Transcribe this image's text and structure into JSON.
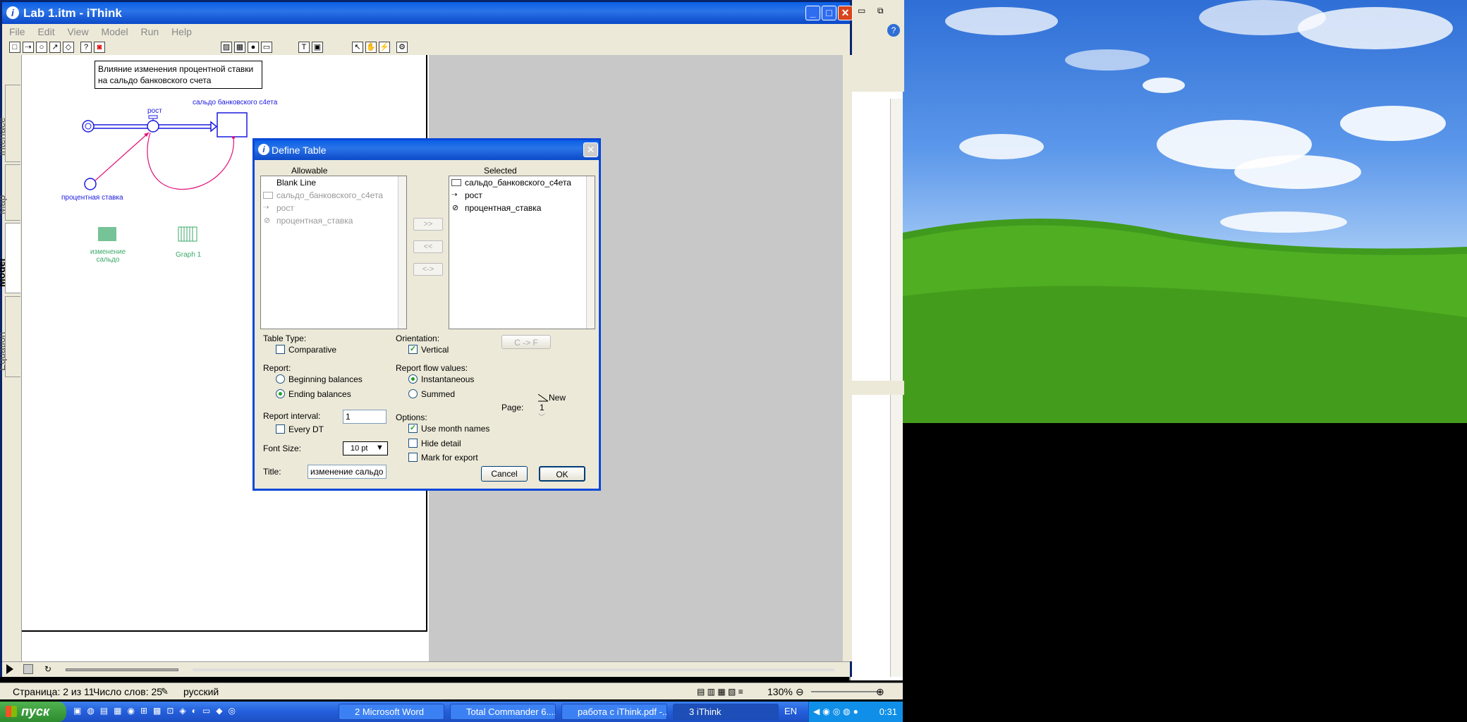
{
  "app": {
    "title": "Lab 1.itm - iThink",
    "menu": [
      "File",
      "Edit",
      "View",
      "Model",
      "Run",
      "Help"
    ],
    "side_tabs": [
      "Interface",
      "Map",
      "Model",
      "Equation"
    ],
    "active_tab": "Model"
  },
  "model": {
    "text_box_line1": "Влияние изменения процентной ставки",
    "text_box_line2": "на сальдо банковского счета",
    "stock_label": "сальдо банковского с4ета",
    "flow_label": "рост",
    "converter_label": "процентная ставка",
    "table_label_line1": "изменение",
    "table_label_line2": "сальдо",
    "graph_label": "Graph 1"
  },
  "dialog": {
    "title": "Define Table",
    "allowable_header": "Allowable",
    "selected_header": "Selected",
    "allowable_items": [
      "Blank Line",
      "сальдо_банковского_с4ета",
      "рост",
      "процентная_ставка"
    ],
    "selected_items": [
      "сальдо_банковского_с4ета",
      "рост",
      "процентная_ставка"
    ],
    "add_btn": ">>",
    "remove_btn": "<<",
    "swap_btn": "<->",
    "cf_btn": "C -> F",
    "table_type_label": "Table Type:",
    "comparative_label": "Comparative",
    "comparative_checked": false,
    "orientation_label": "Orientation:",
    "vertical_label": "Vertical",
    "vertical_checked": true,
    "report_label": "Report:",
    "beginning_label": "Beginning balances",
    "ending_label": "Ending balances",
    "report_selected": "Ending balances",
    "flow_values_label": "Report flow values:",
    "instantaneous_label": "Instantaneous",
    "summed_label": "Summed",
    "flow_selected": "Instantaneous",
    "interval_label": "Report interval:",
    "interval_value": "1",
    "every_dt_label": "Every DT",
    "every_dt_checked": false,
    "options_label": "Options:",
    "use_month_label": "Use month names",
    "use_month_checked": true,
    "hide_detail_label": "Hide detail",
    "hide_detail_checked": false,
    "mark_export_label": "Mark for export",
    "mark_export_checked": false,
    "page_label": "Page:",
    "page_new": "New",
    "page_value": "1",
    "font_size_label": "Font Size:",
    "font_size_value": "10 pt",
    "title_label": "Title:",
    "title_value": "изменение сальдо",
    "cancel": "Cancel",
    "ok": "OK"
  },
  "word_status": {
    "page": "Страница: 2 из 11",
    "words": "Число слов: 25",
    "language": "русский",
    "zoom": "130%"
  },
  "taskbar": {
    "start": "пуск",
    "tasks": [
      "2 Microsoft Word",
      "Total Commander 6....",
      "работа с iThink.pdf -...",
      "3 iThink"
    ],
    "lang": "EN",
    "clock": "0:31"
  },
  "colors": {
    "titlebar": "#0a5fe6",
    "flow_blue": "#1a1ae0",
    "connector_pink": "#e0107a",
    "model_green": "#3aaa6a"
  }
}
